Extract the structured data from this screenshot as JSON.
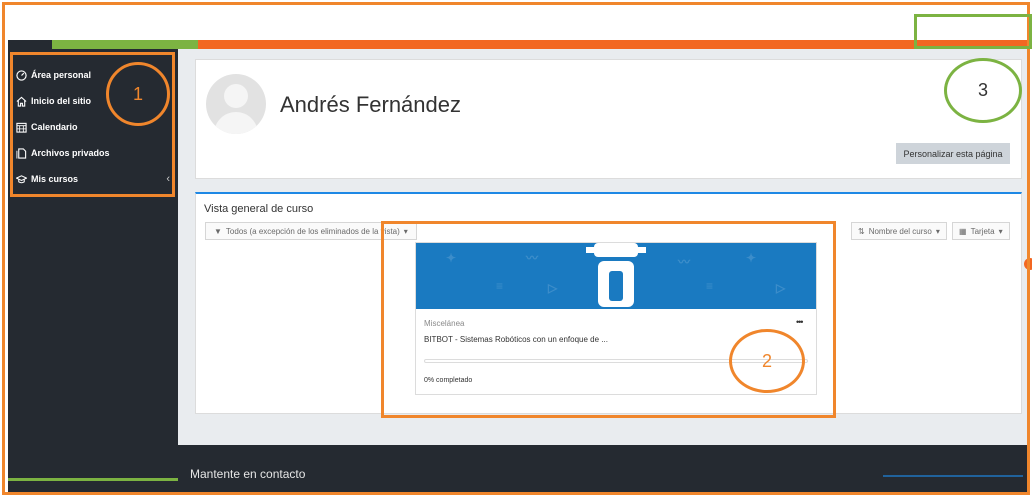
{
  "sidebar": {
    "items": [
      {
        "label": "Área personal",
        "icon": "dashboard-icon"
      },
      {
        "label": "Inicio del sitio",
        "icon": "home-icon"
      },
      {
        "label": "Calendario",
        "icon": "calendar-icon"
      },
      {
        "label": "Archivos privados",
        "icon": "files-icon"
      },
      {
        "label": "Mis cursos",
        "icon": "graduation-cap-icon"
      }
    ],
    "collapse_glyph": "‹"
  },
  "header": {
    "user_name": "Andrés Fernández",
    "customize_label": "Personalizar esta página"
  },
  "overview": {
    "title": "Vista general de curso",
    "filter_label": "Todos (a excepción de los eliminados de la vista)",
    "sort_label": "Nombre del curso",
    "view_label": "Tarjeta"
  },
  "course": {
    "category": "Miscelánea",
    "name": "BITBOT - Sistemas Robóticos con un enfoque de ...",
    "menu_glyph": "•••",
    "progress_percent": 0,
    "progress_label": "0% completado"
  },
  "footer": {
    "title": "Mantente en contacto"
  },
  "annotations": {
    "label_1": "1",
    "label_2": "2",
    "label_3": "3"
  },
  "colors": {
    "accent_orange": "#f26722",
    "accent_green": "#7cb342",
    "accent_blue": "#1e88e5",
    "sidebar_bg": "#252a31",
    "course_image_bg": "#1a7ac1"
  }
}
